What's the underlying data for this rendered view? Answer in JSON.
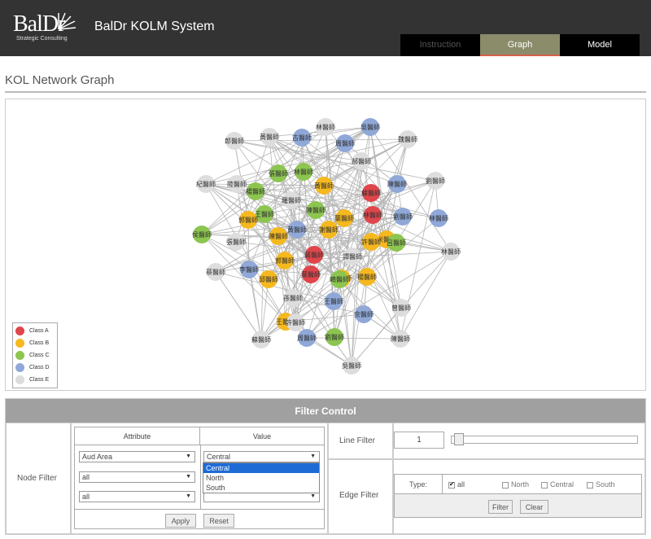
{
  "header": {
    "logo_main": "BalDr",
    "logo_sub": "Strategic Consulting",
    "app_title": "BalDr KOLM System",
    "tabs": [
      {
        "label": "Instruction",
        "active": false
      },
      {
        "label": "Graph",
        "active": true
      },
      {
        "label": "Model",
        "active": false
      }
    ]
  },
  "page": {
    "title": "KOL Network Graph"
  },
  "colors": {
    "class_a": "#e0454b",
    "class_b": "#f5b81e",
    "class_c": "#8cc54f",
    "class_d": "#8fa8d8",
    "class_e": "#dddddd",
    "active_tab": "#8a8c6a",
    "filter_header": "#a0a0a0"
  },
  "legend": {
    "items": [
      {
        "label": "Class A",
        "color": "#e0454b"
      },
      {
        "label": "Class B",
        "color": "#f5b81e"
      },
      {
        "label": "Class C",
        "color": "#8cc54f"
      },
      {
        "label": "Class D",
        "color": "#8fa8d8"
      },
      {
        "label": "Class E",
        "color": "#dddddd"
      }
    ]
  },
  "graph": {
    "nodes": [
      {
        "label": "郎醫師",
        "cls": "E"
      },
      {
        "label": "黃醫師",
        "cls": "E"
      },
      {
        "label": "古醫師",
        "cls": "D"
      },
      {
        "label": "林醫師",
        "cls": "E"
      },
      {
        "label": "吳醫師",
        "cls": "D"
      },
      {
        "label": "周醫師",
        "cls": "D"
      },
      {
        "label": "魏醫師",
        "cls": "E"
      },
      {
        "label": "陸醫師",
        "cls": "E"
      },
      {
        "label": "紀醫師",
        "cls": "E"
      },
      {
        "label": "楊醫師",
        "cls": "C"
      },
      {
        "label": "林醫師",
        "cls": "C"
      },
      {
        "label": "張醫師",
        "cls": "C"
      },
      {
        "label": "黃醫師",
        "cls": "B"
      },
      {
        "label": "郝醫師",
        "cls": "E"
      },
      {
        "label": "蘇醫師",
        "cls": "A"
      },
      {
        "label": "陳醫師",
        "cls": "D"
      },
      {
        "label": "劉醫師",
        "cls": "E"
      },
      {
        "label": "羅醫師",
        "cls": "E"
      },
      {
        "label": "王醫師",
        "cls": "C"
      },
      {
        "label": "陳醫師",
        "cls": "C"
      },
      {
        "label": "葉醫師",
        "cls": "B"
      },
      {
        "label": "林醫師",
        "cls": "A"
      },
      {
        "label": "劉醫師",
        "cls": "D"
      },
      {
        "label": "林醫師",
        "cls": "D"
      },
      {
        "label": "郭醫師",
        "cls": "B"
      },
      {
        "label": "黃醫師",
        "cls": "D"
      },
      {
        "label": "陳醫師",
        "cls": "B"
      },
      {
        "label": "侯醫師",
        "cls": "C"
      },
      {
        "label": "張醫師",
        "cls": "E"
      },
      {
        "label": "謝醫師",
        "cls": "B"
      },
      {
        "label": "米醫師",
        "cls": "B"
      },
      {
        "label": "許醫師",
        "cls": "B"
      },
      {
        "label": "呂醫師",
        "cls": "C"
      },
      {
        "label": "林醫師",
        "cls": "E"
      },
      {
        "label": "李醫師",
        "cls": "D"
      },
      {
        "label": "郭醫師",
        "cls": "B"
      },
      {
        "label": "葉醫師",
        "cls": "A"
      },
      {
        "label": "譚醫師",
        "cls": "E"
      },
      {
        "label": "蔡醫師",
        "cls": "E"
      },
      {
        "label": "蔣醫師",
        "cls": "A"
      },
      {
        "label": "莊醫師",
        "cls": "B"
      },
      {
        "label": "賴醫師",
        "cls": "C"
      },
      {
        "label": "邱醫師",
        "cls": "B"
      },
      {
        "label": "楊醫師",
        "cls": "B"
      },
      {
        "label": "孫醫師",
        "cls": "E"
      },
      {
        "label": "王醫師",
        "cls": "D"
      },
      {
        "label": "余醫師",
        "cls": "D"
      },
      {
        "label": "曾醫師",
        "cls": "E"
      },
      {
        "label": "王醫師",
        "cls": "B"
      },
      {
        "label": "蘇醫師",
        "cls": "E"
      },
      {
        "label": "周醫師",
        "cls": "D"
      },
      {
        "label": "劉醫師",
        "cls": "C"
      },
      {
        "label": "陳醫師",
        "cls": "E"
      },
      {
        "label": "吳醫師",
        "cls": "E"
      },
      {
        "label": "許醫師",
        "cls": "E"
      }
    ]
  },
  "filter": {
    "title": "Filter Control",
    "node_filter_label": "Node Filter",
    "attribute_header": "Attribute",
    "value_header": "Value",
    "rows": [
      {
        "attribute": "Aud Area",
        "value": "Central"
      },
      {
        "attribute": "all",
        "value": ""
      },
      {
        "attribute": "all",
        "value": ""
      }
    ],
    "dropdown_options": [
      "Central",
      "North",
      "South"
    ],
    "dropdown_selected": "Central",
    "apply_label": "Apply",
    "reset_label": "Reset",
    "line_filter_label": "Line Filter",
    "line_filter_value": "1",
    "edge_filter_label": "Edge Filter",
    "type_label": "Type:",
    "types": [
      {
        "label": "all",
        "checked": true
      },
      {
        "label": "North",
        "checked": false
      },
      {
        "label": "Central",
        "checked": false
      },
      {
        "label": "South",
        "checked": false
      }
    ],
    "filter_button": "Filter",
    "clear_button": "Clear"
  }
}
